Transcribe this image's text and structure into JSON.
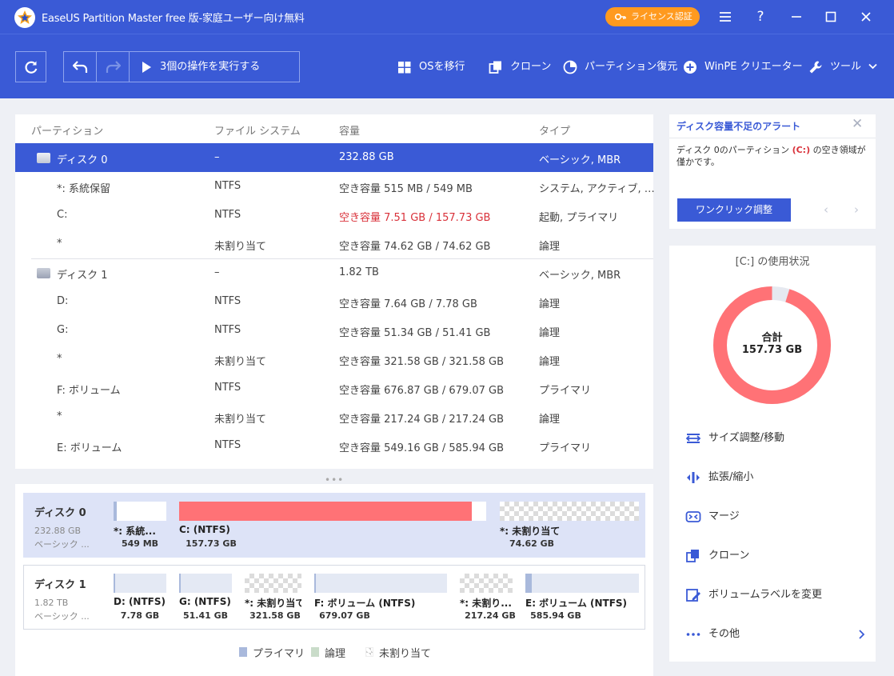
{
  "titlebar": {
    "title": "EaseUS Partition Master free 版-家庭ユーザー向け無料",
    "license_label": "ライセンス認証",
    "menu_icon": "hamburger-icon",
    "help_label": "?"
  },
  "toolbar": {
    "apply_label": "3個の操作を実行する",
    "items": [
      {
        "label": "OSを移行",
        "icon": "windows-icon"
      },
      {
        "label": "クローン",
        "icon": "clone-icon"
      },
      {
        "label": "パーティション復元",
        "icon": "partition-recovery-icon"
      },
      {
        "label": "WinPE クリエーター",
        "icon": "plus-circle-icon"
      },
      {
        "label": "ツール",
        "icon": "wrench-icon"
      }
    ]
  },
  "partition_list": {
    "columns": [
      "パーティション",
      "ファイル システム",
      "容量",
      "タイプ"
    ],
    "disk0": {
      "name": "ディスク 0",
      "fs": "–",
      "capacity": "232.88 GB",
      "type": "ベーシック, MBR"
    },
    "disk0_parts": [
      {
        "name": "*: 系統保留",
        "fs": "NTFS",
        "capacity": "空き容量 515 MB / 549 MB",
        "type": "システム, アクティブ, …"
      },
      {
        "name": "C:",
        "fs": "NTFS",
        "capacity": "空き容量 7.51 GB / 157.73 GB",
        "type": "起動, プライマリ"
      },
      {
        "name": "*",
        "fs": "未割り当て",
        "capacity": "空き容量 74.62 GB / 74.62 GB",
        "type": "論理"
      }
    ],
    "disk1": {
      "name": "ディスク 1",
      "fs": "–",
      "capacity": "1.82 TB",
      "type": "ベーシック, MBR"
    },
    "disk1_parts": [
      {
        "name": "D:",
        "fs": "NTFS",
        "capacity": "空き容量 7.64 GB / 7.78 GB",
        "type": "論理"
      },
      {
        "name": "G:",
        "fs": "NTFS",
        "capacity": "空き容量 51.34 GB / 51.41 GB",
        "type": "論理"
      },
      {
        "name": "*",
        "fs": "未割り当て",
        "capacity": "空き容量 321.58 GB / 321.58 GB",
        "type": "論理"
      },
      {
        "name": "F: ボリューム",
        "fs": "NTFS",
        "capacity": "空き容量 676.87 GB / 679.07 GB",
        "type": "プライマリ"
      },
      {
        "name": "*",
        "fs": "未割り当て",
        "capacity": "空き容量 217.24 GB / 217.24 GB",
        "type": "論理"
      },
      {
        "name": "E: ボリューム",
        "fs": "NTFS",
        "capacity": "空き容量 549.16 GB / 585.94 GB",
        "type": "プライマリ"
      }
    ]
  },
  "disk_map": {
    "disk0": {
      "name": "ディスク 0",
      "size": "232.88 GB",
      "type": "ベーシック ...",
      "parts": [
        {
          "name": "*: 系統...",
          "size": "549 MB"
        },
        {
          "name": "C: (NTFS)",
          "size": "157.73 GB",
          "used_fraction": 0.95
        },
        {
          "name": "*: 未割り当て",
          "size": "74.62 GB"
        }
      ]
    },
    "disk1": {
      "name": "ディスク 1",
      "size": "1.82 TB",
      "type": "ベーシック ...",
      "parts": [
        {
          "name": "D: (NTFS)",
          "size": "7.78 GB"
        },
        {
          "name": "G: (NTFS)",
          "size": "51.41 GB"
        },
        {
          "name": "*: 未割り当て",
          "size": "321.58 GB"
        },
        {
          "name": "F: ボリューム (NTFS)",
          "size": "679.07 GB"
        },
        {
          "name": "*: 未割り...",
          "size": "217.24 GB"
        },
        {
          "name": "E: ボリューム (NTFS)",
          "size": "585.94 GB",
          "used_fraction": 0.06
        }
      ]
    },
    "legend": [
      "プライマリ",
      "論理",
      "未割り当て"
    ]
  },
  "alert": {
    "title": "ディスク容量不足のアラート",
    "msg_before": "ディスク 0のパーティション",
    "msg_drive": "(C:)",
    "msg_after": "の空き領域が僅かです。",
    "button": "ワンクリック調整"
  },
  "usage": {
    "title": "[C:] の使用状況",
    "total_label": "合計",
    "total_value": "157.73 GB",
    "used_fraction": 0.952,
    "used_color": "#ff7276",
    "free_color": "#e6e9f0"
  },
  "actions": [
    {
      "label": "サイズ調整/移動",
      "icon": "resize-move-icon"
    },
    {
      "label": "拡張/縮小",
      "icon": "extend-shrink-icon"
    },
    {
      "label": "マージ",
      "icon": "merge-icon"
    },
    {
      "label": "クローン",
      "icon": "clone-icon"
    },
    {
      "label": "ボリュームラベルを変更",
      "icon": "edit-label-icon"
    },
    {
      "label": "その他",
      "icon": "more-icon"
    }
  ],
  "colors": {
    "accent": "#3a5ad6",
    "orange": "#ff9a1f",
    "c_drive_bar": "#ff7276",
    "primary_swatch": "#a9b9dc",
    "logical_swatch": "#c9dcc9"
  }
}
